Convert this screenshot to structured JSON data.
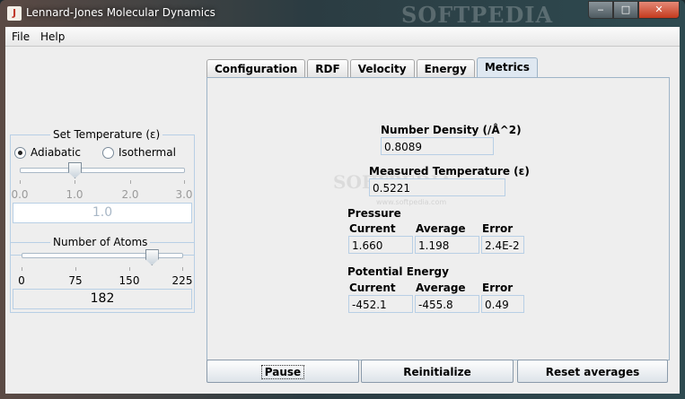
{
  "window": {
    "title": "Lennard-Jones Molecular Dynamics",
    "watermark": "SOFTPEDIA",
    "min_glyph": "‒",
    "max_glyph": "□",
    "close_glyph": "✕",
    "app_icon_glyph": "J"
  },
  "menu": {
    "file": "File",
    "help": "Help"
  },
  "temperature": {
    "legend": "Set Temperature (ε)",
    "mode_adiabatic": "Adiabatic",
    "mode_isothermal": "Isothermal",
    "selected_mode": "Adiabatic",
    "ticks": [
      "0.0",
      "1.0",
      "2.0",
      "3.0"
    ],
    "slider_min": 0,
    "slider_max": 3,
    "slider_value": 1.0,
    "value_text": "1.0"
  },
  "atoms": {
    "legend": "Number of Atoms",
    "ticks": [
      "0",
      "75",
      "150",
      "225"
    ],
    "slider_min": 0,
    "slider_max": 225,
    "slider_value": 182,
    "value_text": "182"
  },
  "tabs": [
    {
      "label": "Configuration"
    },
    {
      "label": "RDF"
    },
    {
      "label": "Velocity"
    },
    {
      "label": "Energy"
    },
    {
      "label": "Metrics"
    }
  ],
  "active_tab": "Metrics",
  "metrics": {
    "watermark_text": "SOFTPEDIA",
    "watermark_url": "www.softpedia.com",
    "number_density": {
      "label": "Number Density (/Å^2)",
      "value": "0.8089"
    },
    "measured_temperature": {
      "label": "Measured Temperature (ε)",
      "value": "0.5221"
    },
    "pressure": {
      "label": "Pressure",
      "current_label": "Current",
      "average_label": "Average",
      "error_label": "Error",
      "current": "1.660",
      "average": "1.198",
      "error": "2.4E-2"
    },
    "potential_energy": {
      "label": "Potential Energy",
      "current_label": "Current",
      "average_label": "Average",
      "error_label": "Error",
      "current": "-452.1",
      "average": "-455.8",
      "error": "0.49"
    }
  },
  "buttons": {
    "pause": "Pause",
    "reinitialize": "Reinitialize",
    "reset_averages": "Reset averages"
  }
}
